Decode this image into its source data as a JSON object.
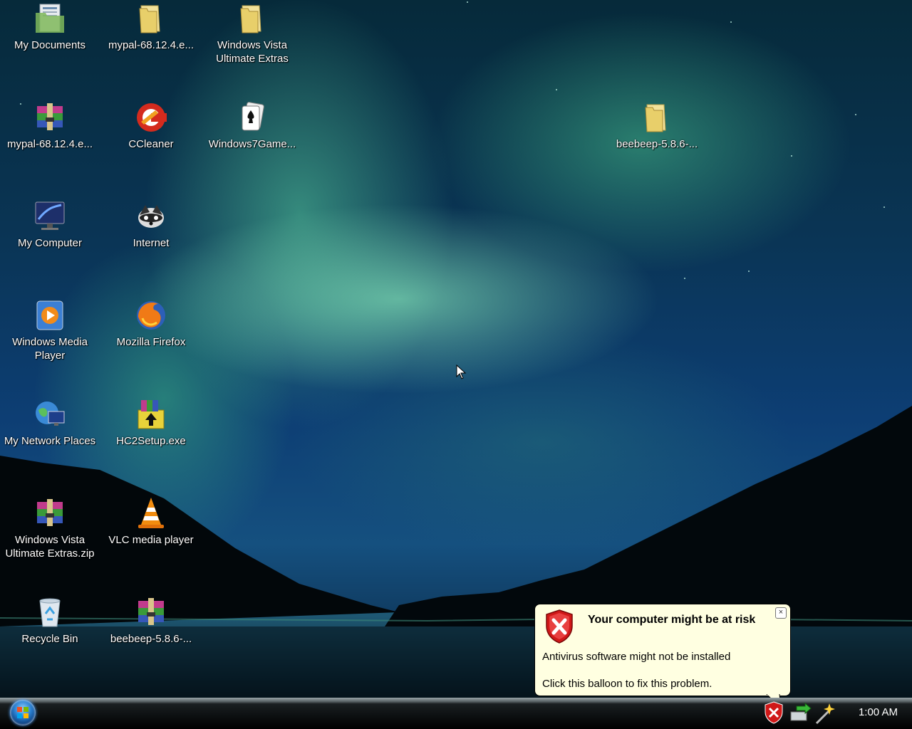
{
  "desktop_icons": [
    {
      "label": "My Documents",
      "icon": "documents-folder-icon"
    },
    {
      "label": "mypal-68.12.4.e...",
      "icon": "folder-icon"
    },
    {
      "label": "Windows Vista Ultimate Extras",
      "icon": "folder-icon"
    },
    {
      "label": "mypal-68.12.4.e...",
      "icon": "winrar-archive-icon"
    },
    {
      "label": "CCleaner",
      "icon": "ccleaner-icon"
    },
    {
      "label": "Windows7Game...",
      "icon": "solitaire-games-icon"
    },
    {
      "label": "beebeep-5.8.6-...",
      "icon": "folder-icon"
    },
    {
      "label": "My Computer",
      "icon": "computer-monitor-icon"
    },
    {
      "label": "Internet",
      "icon": "raccoon-browser-icon"
    },
    {
      "label": "Windows Media Player",
      "icon": "media-player-icon"
    },
    {
      "label": "Mozilla Firefox",
      "icon": "firefox-icon"
    },
    {
      "label": "My Network Places",
      "icon": "network-globe-icon"
    },
    {
      "label": "HC2Setup.exe",
      "icon": "installer-box-icon"
    },
    {
      "label": "Windows Vista Ultimate Extras.zip",
      "icon": "winrar-archive-icon"
    },
    {
      "label": "VLC media player",
      "icon": "vlc-cone-icon"
    },
    {
      "label": "Recycle Bin",
      "icon": "recycle-bin-icon"
    },
    {
      "label": "beebeep-5.8.6-...",
      "icon": "winrar-archive-icon"
    }
  ],
  "balloon": {
    "title": "Your computer might be at risk",
    "line1": "Antivirus software might not be installed",
    "line2": "Click this balloon to fix this problem.",
    "close": "×"
  },
  "taskbar": {
    "clock": "1:00 AM",
    "tray_icons": [
      "security-shield-icon",
      "network-icon",
      "wand-icon"
    ]
  },
  "colors": {
    "balloon_bg": "#ffffe1",
    "shield_red": "#d01818",
    "aurora_green": "#8cf0be"
  }
}
